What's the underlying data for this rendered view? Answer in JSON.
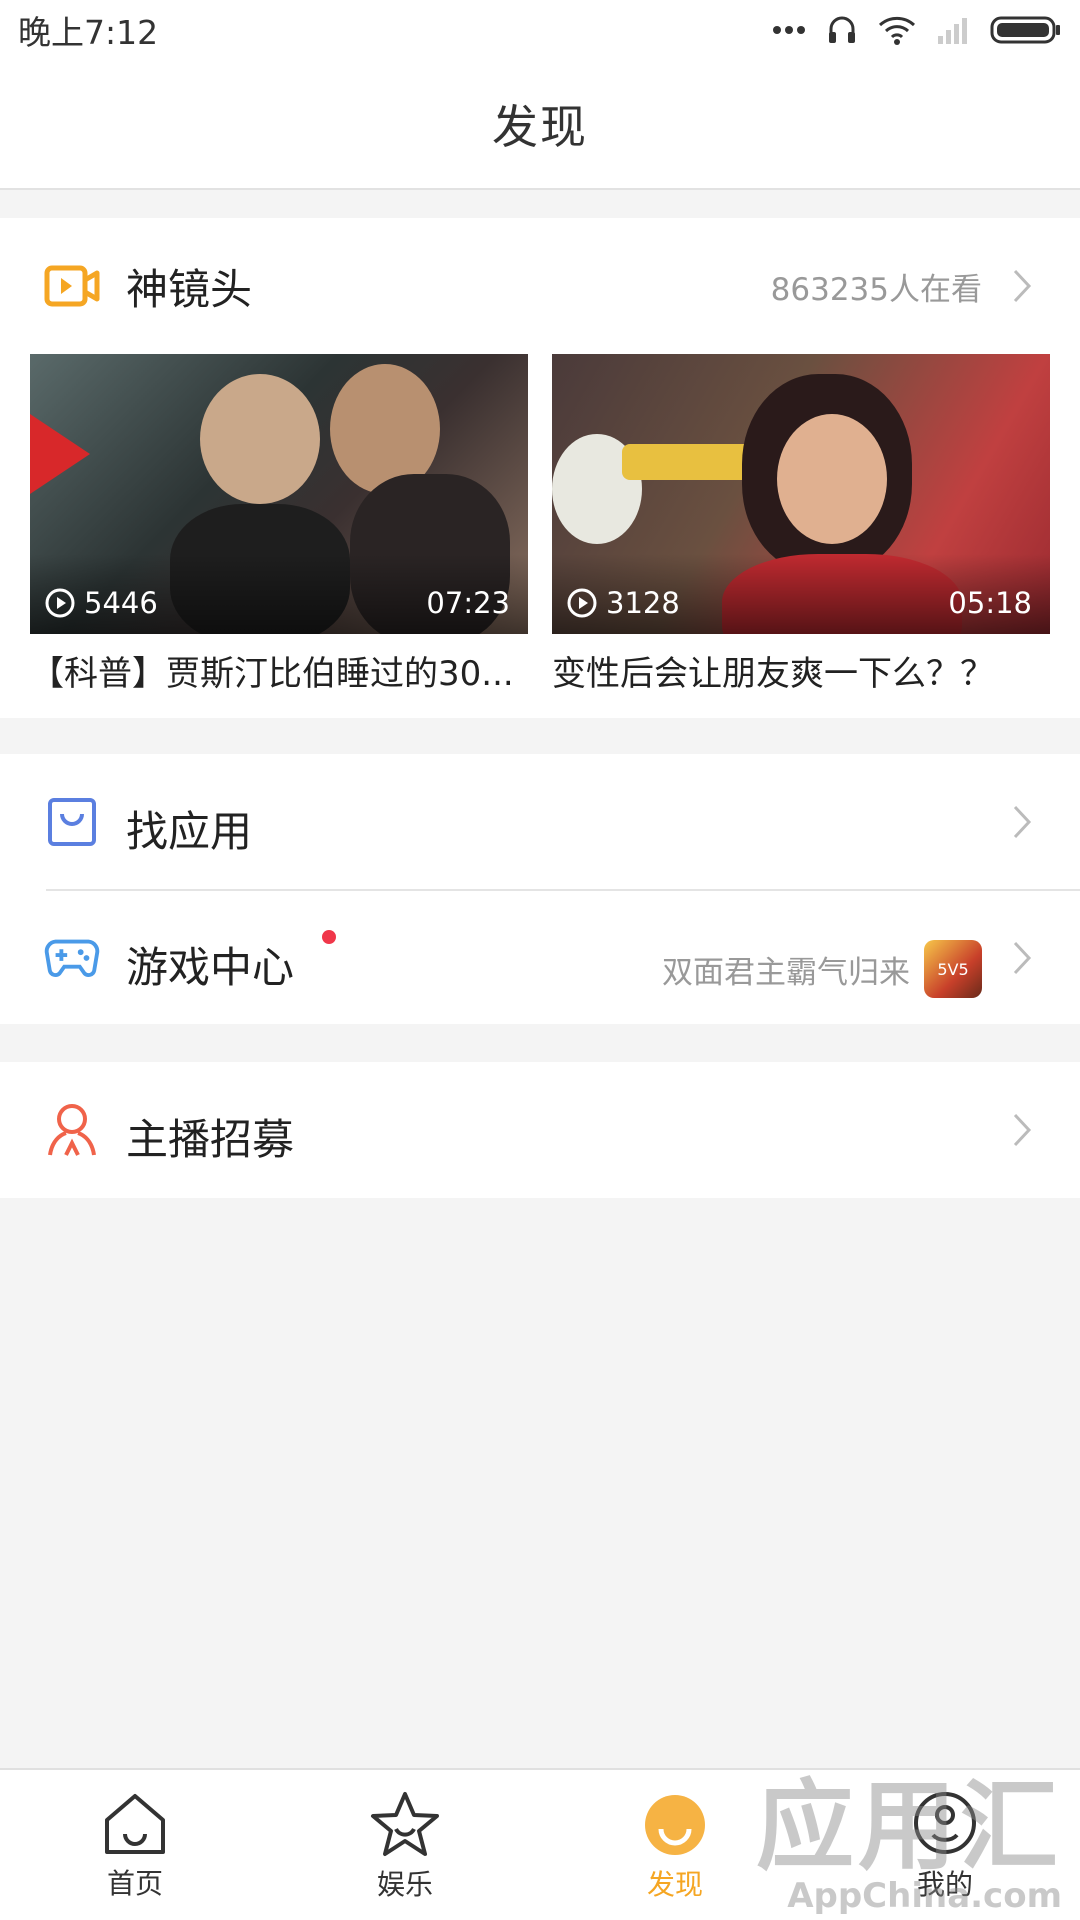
{
  "status_bar": {
    "time": "晚上7:12",
    "icons": [
      "more-dots-icon",
      "headset-icon",
      "wifi-icon",
      "signal-icon",
      "battery-icon"
    ]
  },
  "header": {
    "title": "发现"
  },
  "highlights": {
    "label": "神镜头",
    "icon": "video-camera-icon",
    "viewers": "863235人在看",
    "videos": [
      {
        "play_count": "5446",
        "duration": "07:23",
        "title": "【科普】贾斯汀比伯睡过的30..."
      },
      {
        "play_count": "3128",
        "duration": "05:18",
        "title": "变性后会让朋友爽一下么？？"
      }
    ]
  },
  "menu": {
    "find_apps": {
      "label": "找应用",
      "icon": "shopping-bag-icon"
    },
    "game_center": {
      "label": "游戏中心",
      "icon": "gamepad-icon",
      "promo": "双面君主霸气归来"
    },
    "host_recruit": {
      "label": "主播招募",
      "icon": "user-icon"
    }
  },
  "bottom_nav": {
    "items": [
      {
        "label": "首页",
        "icon": "home-icon"
      },
      {
        "label": "娱乐",
        "icon": "star-icon"
      },
      {
        "label": "发现",
        "icon": "discover-icon",
        "active": true
      },
      {
        "label": "我的",
        "icon": "profile-icon"
      }
    ]
  },
  "watermark": {
    "cn": "应用汇",
    "en": "AppChina.com"
  },
  "colors": {
    "accent": "#f5a623",
    "app_icon_blue": "#5b7fe0",
    "game_icon_blue": "#4a9ae8",
    "recruit_icon_red": "#f0634a",
    "badge_red": "#f0374a"
  }
}
